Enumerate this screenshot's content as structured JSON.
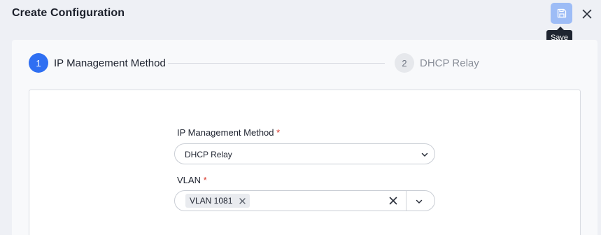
{
  "header": {
    "title": "Create Configuration",
    "save_icon": "save-icon",
    "close_icon": "close-icon",
    "save_tooltip": "Save"
  },
  "stepper": {
    "steps": [
      {
        "number": "1",
        "label": "IP Management Method",
        "state": "active"
      },
      {
        "number": "2",
        "label": "DHCP Relay",
        "state": "inactive"
      }
    ]
  },
  "form": {
    "ip_method": {
      "label": "IP Management Method",
      "required_mark": "*",
      "value": "DHCP Relay"
    },
    "vlan": {
      "label": "VLAN",
      "required_mark": "*",
      "chips": [
        "VLAN 1081"
      ]
    }
  },
  "colors": {
    "accent": "#2f6ff2",
    "save_button": "#9dbcf6",
    "required": "#d9372b"
  }
}
